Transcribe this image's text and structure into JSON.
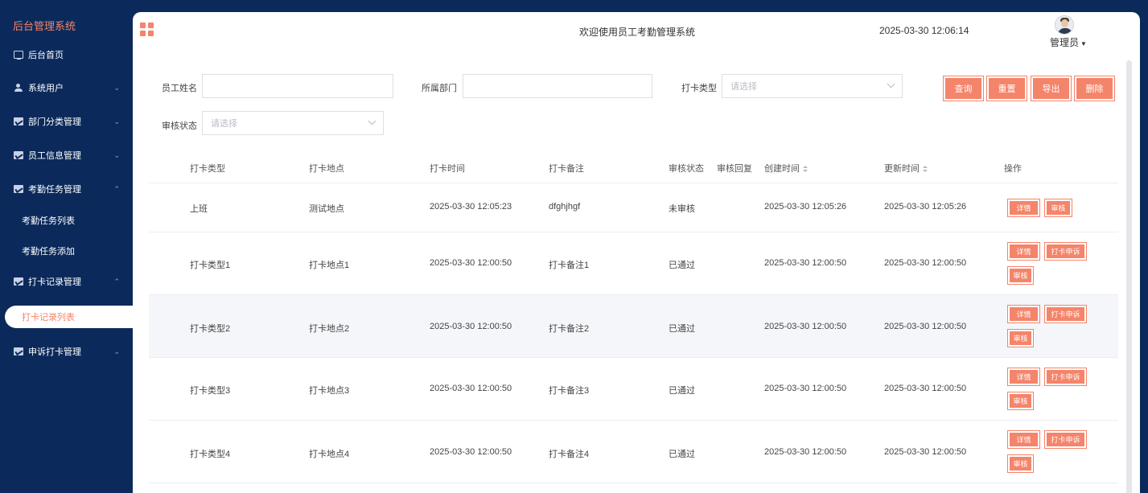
{
  "sidebar": {
    "title": "后台管理系统",
    "items": [
      {
        "label": "后台首页"
      },
      {
        "label": "系统用户"
      },
      {
        "label": "部门分类管理"
      },
      {
        "label": "员工信息管理"
      },
      {
        "label": "考勤任务管理"
      },
      {
        "label": "考勤任务列表"
      },
      {
        "label": "考勤任务添加"
      },
      {
        "label": "打卡记录管理"
      },
      {
        "label": "打卡记录列表"
      },
      {
        "label": "申诉打卡管理"
      }
    ]
  },
  "header": {
    "title": "欢迎使用员工考勤管理系统",
    "datetime": "2025-03-30 12:06:14",
    "user": "管理员"
  },
  "search": {
    "name_label": "员工姓名",
    "name_value": "",
    "dept_label": "所属部门",
    "dept_value": "",
    "type_label": "打卡类型",
    "type_placeholder": "请选择",
    "status_label": "审核状态",
    "status_placeholder": "请选择"
  },
  "buttons": {
    "query": "查询",
    "reset": "重置",
    "export": "导出",
    "delete": "删除"
  },
  "table": {
    "headers": [
      "打卡类型",
      "打卡地点",
      "打卡时间",
      "打卡备注",
      "审核状态",
      "审核回复",
      "创建时间",
      "更新时间",
      "操作"
    ],
    "rows": [
      {
        "type": "上班",
        "location": "测试地点",
        "time": "2025-03-30 12:05:23",
        "note": "dfghjhgf",
        "status": "未审核",
        "reply": "",
        "created": "2025-03-30 12:05:26",
        "updated": "2025-03-30 12:05:26"
      },
      {
        "type": "打卡类型1",
        "location": "打卡地点1",
        "time": "2025-03-30 12:00:50",
        "note": "打卡备注1",
        "status": "已通过",
        "reply": "",
        "created": "2025-03-30 12:00:50",
        "updated": "2025-03-30 12:00:50"
      },
      {
        "type": "打卡类型2",
        "location": "打卡地点2",
        "time": "2025-03-30 12:00:50",
        "note": "打卡备注2",
        "status": "已通过",
        "reply": "",
        "created": "2025-03-30 12:00:50",
        "updated": "2025-03-30 12:00:50"
      },
      {
        "type": "打卡类型3",
        "location": "打卡地点3",
        "time": "2025-03-30 12:00:50",
        "note": "打卡备注3",
        "status": "已通过",
        "reply": "",
        "created": "2025-03-30 12:00:50",
        "updated": "2025-03-30 12:00:50"
      },
      {
        "type": "打卡类型4",
        "location": "打卡地点4",
        "time": "2025-03-30 12:00:50",
        "note": "打卡备注4",
        "status": "已通过",
        "reply": "",
        "created": "2025-03-30 12:00:50",
        "updated": "2025-03-30 12:00:50"
      }
    ],
    "actions": {
      "detail": "详情",
      "review": "审核",
      "appeal": "打卡申诉"
    }
  },
  "colors": {
    "accent": "#f4846a",
    "sidebar_bg": "#0b2a5b",
    "stripe": "#f5f6fa"
  }
}
